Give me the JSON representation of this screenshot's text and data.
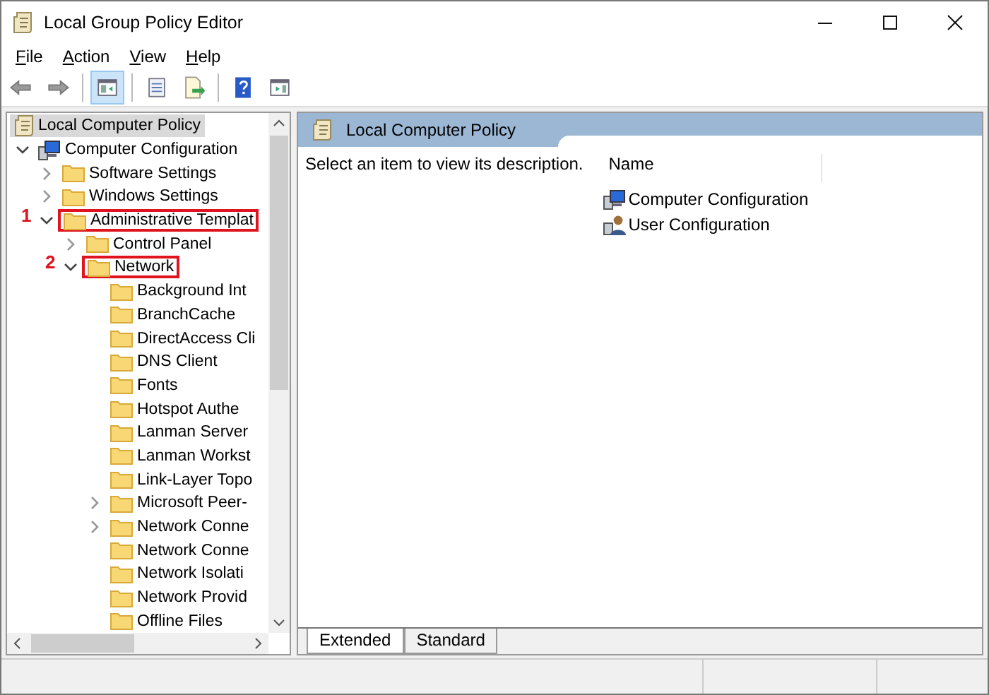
{
  "window": {
    "title": "Local Group Policy Editor"
  },
  "menu": [
    {
      "label": "File"
    },
    {
      "label": "Action"
    },
    {
      "label": "View"
    },
    {
      "label": "Help"
    }
  ],
  "toolbar": [
    [
      {
        "kind": "back",
        "pressed": false
      },
      {
        "kind": "forward",
        "pressed": false
      }
    ],
    [
      {
        "kind": "tree-toggle",
        "pressed": true
      }
    ],
    [
      {
        "kind": "properties",
        "pressed": false
      },
      {
        "kind": "export",
        "pressed": false
      }
    ],
    [
      {
        "kind": "help",
        "pressed": false
      },
      {
        "kind": "action-pane",
        "pressed": false
      }
    ]
  ],
  "tree": [
    {
      "label": "Local Computer Policy",
      "kind": "policy",
      "selected": true,
      "children": [
        {
          "label": "Computer Configuration",
          "kind": "computer",
          "expanded": true,
          "selected": false,
          "children": [
            {
              "label": "Software Settings",
              "kind": "folder",
              "expanded": false,
              "selected": false
            },
            {
              "label": "Windows Settings",
              "kind": "folder",
              "expanded": false,
              "selected": false
            },
            {
              "label": "Administrative Templat",
              "kind": "folder",
              "expanded": true,
              "selected": false,
              "annotation": "1",
              "children": [
                {
                  "label": "Control Panel",
                  "kind": "folder",
                  "expanded": false,
                  "selected": false
                },
                {
                  "label": "Network",
                  "kind": "folder",
                  "expanded": true,
                  "selected": false,
                  "annotation": "2",
                  "children": [
                    {
                      "label": "Background Int",
                      "kind": "folder",
                      "selected": false
                    },
                    {
                      "label": "BranchCache",
                      "kind": "folder",
                      "selected": false
                    },
                    {
                      "label": "DirectAccess Cli",
                      "kind": "folder",
                      "selected": false
                    },
                    {
                      "label": "DNS Client",
                      "kind": "folder",
                      "selected": false
                    },
                    {
                      "label": "Fonts",
                      "kind": "folder",
                      "selected": false
                    },
                    {
                      "label": "Hotspot Authe",
                      "kind": "folder",
                      "selected": false
                    },
                    {
                      "label": "Lanman Server",
                      "kind": "folder",
                      "selected": false
                    },
                    {
                      "label": "Lanman Workst",
                      "kind": "folder",
                      "selected": false
                    },
                    {
                      "label": "Link-Layer Topo",
                      "kind": "folder",
                      "selected": false
                    },
                    {
                      "label": "Microsoft Peer-",
                      "kind": "folder",
                      "expanded": false,
                      "selected": false
                    },
                    {
                      "label": "Network Conne",
                      "kind": "folder",
                      "expanded": false,
                      "selected": false
                    },
                    {
                      "label": "Network Conne",
                      "kind": "folder",
                      "selected": false
                    },
                    {
                      "label": "Network Isolati",
                      "kind": "folder",
                      "selected": false
                    },
                    {
                      "label": "Network Provid",
                      "kind": "folder",
                      "selected": false
                    },
                    {
                      "label": "Offline Files",
                      "kind": "folder",
                      "selected": false
                    }
                  ]
                }
              ]
            }
          ]
        }
      ]
    }
  ],
  "details": {
    "header": "Local Computer Policy",
    "description": "Select an item to view its description.",
    "column": "Name",
    "items": [
      {
        "label": "Computer Configuration",
        "kind": "computer"
      },
      {
        "label": "User Configuration",
        "kind": "user"
      }
    ]
  },
  "view_tabs": [
    {
      "label": "Extended",
      "selected": true
    },
    {
      "label": "Standard",
      "selected": false
    }
  ]
}
